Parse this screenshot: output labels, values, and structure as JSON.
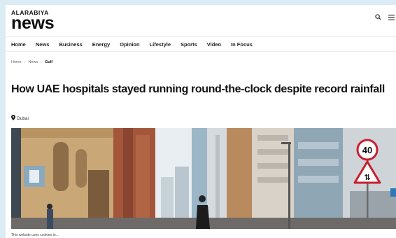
{
  "header": {
    "brand_top": "ALARABIYA",
    "brand_main": "news",
    "search_icon": "search-icon",
    "menu_icon": "hamburger-menu-icon"
  },
  "nav": {
    "items": [
      "Home",
      "News",
      "Business",
      "Energy",
      "Opinion",
      "Lifestyle",
      "Sports",
      "Video",
      "In Focus"
    ]
  },
  "breadcrumb": {
    "items": [
      "Home",
      "News"
    ],
    "separator": "›",
    "current": "Gulf"
  },
  "article": {
    "headline": "How UAE hospitals stayed running round-the-clock despite record rainfall",
    "location": "Dubai",
    "location_icon": "map-pin-icon",
    "caption": "This website uses cookies to..."
  },
  "hero_image": {
    "sign_speed": "40",
    "sign_warning": "⇅"
  },
  "colors": {
    "backdrop": "#dcecf4",
    "sky": "#eef3f6",
    "sign_red": "#c8202f"
  }
}
